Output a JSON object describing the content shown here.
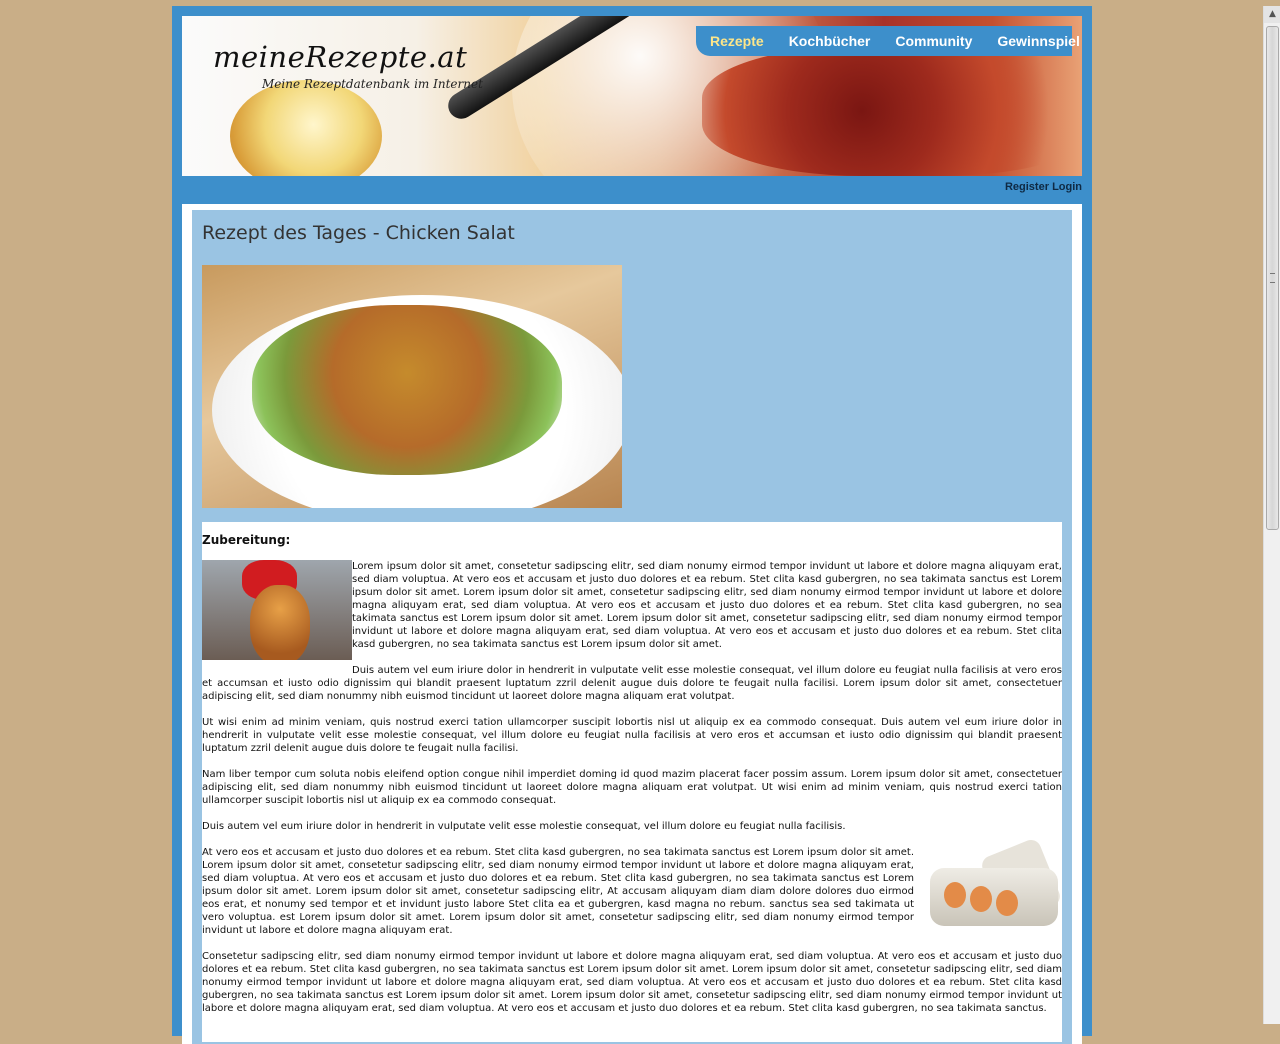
{
  "site": {
    "logo": "meineRezepte.at",
    "tagline": "Meine Rezeptdatenbank im Internet"
  },
  "nav": {
    "items": [
      {
        "label": "Rezepte",
        "active": true
      },
      {
        "label": "Kochbücher",
        "active": false
      },
      {
        "label": "Community",
        "active": false
      },
      {
        "label": "Gewinnspiel",
        "active": false
      }
    ]
  },
  "account": {
    "register": "Register",
    "login": "Login"
  },
  "featured": {
    "title": "Rezept des Tages - Chicken Salat",
    "section_heading": "Zubereitung:",
    "paragraphs": [
      "Lorem ipsum dolor sit amet, consetetur sadipscing elitr, sed diam nonumy eirmod tempor invidunt ut labore et dolore magna aliquyam erat, sed diam voluptua. At vero eos et accusam et justo duo dolores et ea rebum. Stet clita kasd gubergren, no sea takimata sanctus est Lorem ipsum dolor sit amet. Lorem ipsum dolor sit amet, consetetur sadipscing elitr, sed diam nonumy eirmod tempor invidunt ut labore et dolore magna aliquyam erat, sed diam voluptua. At vero eos et accusam et justo duo dolores et ea rebum. Stet clita kasd gubergren, no sea takimata sanctus est Lorem ipsum dolor sit amet. Lorem ipsum dolor sit amet, consetetur sadipscing elitr, sed diam nonumy eirmod tempor invidunt ut labore et dolore magna aliquyam erat, sed diam voluptua. At vero eos et accusam et justo duo dolores et ea rebum. Stet clita kasd gubergren, no sea takimata sanctus est Lorem ipsum dolor sit amet.",
      "Duis autem vel eum iriure dolor in hendrerit in vulputate velit esse molestie consequat, vel illum dolore eu feugiat nulla facilisis at vero eros et accumsan et iusto odio dignissim qui blandit praesent luptatum zzril delenit augue duis dolore te feugait nulla facilisi. Lorem ipsum dolor sit amet, consectetuer adipiscing elit, sed diam nonummy nibh euismod tincidunt ut laoreet dolore magna aliquam erat volutpat.",
      "Ut wisi enim ad minim veniam, quis nostrud exerci tation ullamcorper suscipit lobortis nisl ut aliquip ex ea commodo consequat. Duis autem vel eum iriure dolor in hendrerit in vulputate velit esse molestie consequat, vel illum dolore eu feugiat nulla facilisis at vero eros et accumsan et iusto odio dignissim qui blandit praesent luptatum zzril delenit augue duis dolore te feugait nulla facilisi.",
      "Nam liber tempor cum soluta nobis eleifend option congue nihil imperdiet doming id quod mazim placerat facer possim assum. Lorem ipsum dolor sit amet, consectetuer adipiscing elit, sed diam nonummy nibh euismod tincidunt ut laoreet dolore magna aliquam erat volutpat. Ut wisi enim ad minim veniam, quis nostrud exerci tation ullamcorper suscipit lobortis nisl ut aliquip ex ea commodo consequat.",
      "Duis autem vel eum iriure dolor in hendrerit in vulputate velit esse molestie consequat, vel illum dolore eu feugiat nulla facilisis.",
      "At vero eos et accusam et justo duo dolores et ea rebum. Stet clita kasd gubergren, no sea takimata sanctus est Lorem ipsum dolor sit amet. Lorem ipsum dolor sit amet, consetetur sadipscing elitr, sed diam nonumy eirmod tempor invidunt ut labore et dolore magna aliquyam erat, sed diam voluptua. At vero eos et accusam et justo duo dolores et ea rebum. Stet clita kasd gubergren, no sea takimata sanctus est Lorem ipsum dolor sit amet. Lorem ipsum dolor sit amet, consetetur sadipscing elitr, At accusam aliquyam diam diam dolore dolores duo eirmod eos erat, et nonumy sed tempor et et invidunt justo labore Stet clita ea et gubergren, kasd magna no rebum. sanctus sea sed takimata ut vero voluptua. est Lorem ipsum dolor sit amet. Lorem ipsum dolor sit amet, consetetur sadipscing elitr, sed diam nonumy eirmod tempor invidunt ut labore et dolore magna aliquyam erat.",
      "Consetetur sadipscing elitr, sed diam nonumy eirmod tempor invidunt ut labore et dolore magna aliquyam erat, sed diam voluptua. At vero eos et accusam et justo duo dolores et ea rebum. Stet clita kasd gubergren, no sea takimata sanctus est Lorem ipsum dolor sit amet. Lorem ipsum dolor sit amet, consetetur sadipscing elitr, sed diam nonumy eirmod tempor invidunt ut labore et dolore magna aliquyam erat, sed diam voluptua. At vero eos et accusam et justo duo dolores et ea rebum. Stet clita kasd gubergren, no sea takimata sanctus est Lorem ipsum dolor sit amet. Lorem ipsum dolor sit amet, consetetur sadipscing elitr, sed diam nonumy eirmod tempor invidunt ut labore et dolore magna aliquyam erat, sed diam voluptua. At vero eos et accusam et justo duo dolores et ea rebum. Stet clita kasd gubergren, no sea takimata sanctus."
    ]
  },
  "colors": {
    "background": "#c9ae87",
    "frame": "#3d8fcb",
    "featured_bg": "#9ac4e3",
    "nav_active": "#fde68a"
  }
}
